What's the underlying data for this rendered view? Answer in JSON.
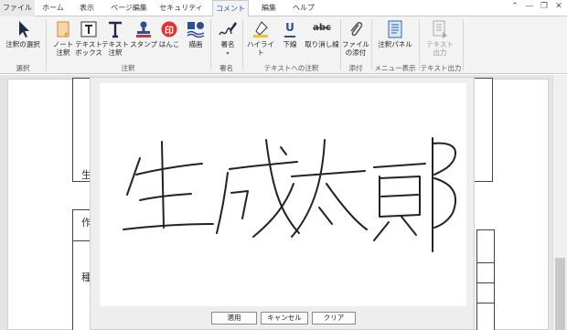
{
  "tabs": [
    {
      "label": "ファイル",
      "active": false
    },
    {
      "label": "ホーム",
      "active": false
    },
    {
      "label": "表示",
      "active": false
    },
    {
      "label": "ページ編集",
      "active": false
    },
    {
      "label": "セキュリティ",
      "active": false
    },
    {
      "label": "コメント",
      "active": true
    },
    {
      "label": "編集",
      "active": false
    },
    {
      "label": "ヘルプ",
      "active": false
    }
  ],
  "window_controls": {
    "collapse": "⌃",
    "minimize": "—",
    "restore": "❐",
    "close": "✕"
  },
  "ribbon": {
    "buttons": [
      {
        "label": "注釈の選択",
        "icon": "cursor-arrow-icon"
      },
      {
        "label": "ノート\n注釈",
        "icon": "sticky-note-icon"
      },
      {
        "label": "テキスト\nボックス",
        "icon": "text-box-icon"
      },
      {
        "label": "テキスト\n注釈",
        "icon": "text-annotation-icon"
      },
      {
        "label": "スタンプ",
        "icon": "stamp-icon"
      },
      {
        "label": "はんこ",
        "icon": "hanko-seal-icon",
        "glyph": "印"
      },
      {
        "label": "描画",
        "icon": "shapes-icon"
      },
      {
        "label": "署名",
        "icon": "signature-pen-icon"
      },
      {
        "label": "ハイライト",
        "icon": "highlighter-icon"
      },
      {
        "label": "下線",
        "icon": "underline-icon",
        "glyph": "U"
      },
      {
        "label": "取り消し線",
        "icon": "strikethrough-icon",
        "glyph": "abc"
      },
      {
        "label": "ファイル\nの添付",
        "icon": "paperclip-icon"
      },
      {
        "label": "注釈パネル",
        "icon": "annotation-panel-icon"
      },
      {
        "label": "テキスト\n出力",
        "icon": "text-export-icon",
        "disabled": true
      }
    ],
    "groups": [
      "選択",
      "注釈",
      "署名",
      "テキストへの注釈",
      "添付",
      "メニュー表示",
      "テキスト出力"
    ]
  },
  "document": {
    "fragments": [
      "生",
      "作",
      "種"
    ]
  },
  "signature_dialog": {
    "handwriting": "生成太郎",
    "buttons": {
      "apply": "適用",
      "cancel": "キャンセル",
      "clear": "クリア"
    }
  },
  "colors": {
    "accent": "#1a56b8",
    "hanko": "#e0322e",
    "stamp": "#2f4f8f"
  }
}
